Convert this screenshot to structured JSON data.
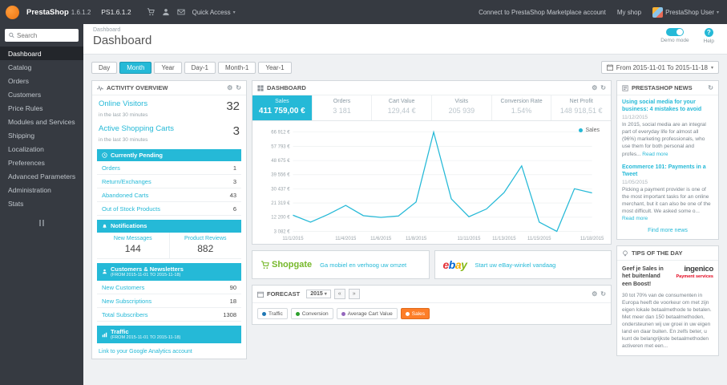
{
  "topbar": {
    "brand": "PrestaShop",
    "version": "1.6.1.2",
    "shop_name": "PS1.6.1.2",
    "quick_access": "Quick Access",
    "marketplace_link": "Connect to PrestaShop Marketplace account",
    "my_shop": "My shop",
    "user_name": "PrestaShop User"
  },
  "sidebar": {
    "search_placeholder": "Search",
    "items": [
      {
        "label": "Dashboard"
      },
      {
        "label": "Catalog"
      },
      {
        "label": "Orders"
      },
      {
        "label": "Customers"
      },
      {
        "label": "Price Rules"
      },
      {
        "label": "Modules and Services"
      },
      {
        "label": "Shipping"
      },
      {
        "label": "Localization"
      },
      {
        "label": "Preferences"
      },
      {
        "label": "Advanced Parameters"
      },
      {
        "label": "Administration"
      },
      {
        "label": "Stats"
      }
    ]
  },
  "page": {
    "breadcrumb": "Dashboard",
    "title": "Dashboard",
    "demo_mode": "Demo mode",
    "help": "Help"
  },
  "filters": {
    "buttons": [
      "Day",
      "Month",
      "Year",
      "Day-1",
      "Month-1",
      "Year-1"
    ],
    "active": "Month",
    "date_range": "From 2015-11-01 To 2015-11-18"
  },
  "activity": {
    "title": "ACTIVITY OVERVIEW",
    "online_visitors": {
      "label": "Online Visitors",
      "value": "32",
      "sub": "in the last 30 minutes"
    },
    "active_carts": {
      "label": "Active Shopping Carts",
      "value": "3",
      "sub": "in the last 30 minutes"
    },
    "pending": {
      "title": "Currently Pending",
      "rows": [
        {
          "label": "Orders",
          "value": "1"
        },
        {
          "label": "Return/Exchanges",
          "value": "3"
        },
        {
          "label": "Abandoned Carts",
          "value": "43"
        },
        {
          "label": "Out of Stock Products",
          "value": "6"
        }
      ]
    },
    "notifications": {
      "title": "Notifications",
      "cells": [
        {
          "label": "New Messages",
          "value": "144"
        },
        {
          "label": "Product Reviews",
          "value": "882"
        }
      ]
    },
    "customers": {
      "title": "Customers & Newsletters",
      "subtitle": "(FROM 2015-11-01 TO 2015-11-18)",
      "rows": [
        {
          "label": "New Customers",
          "value": "90"
        },
        {
          "label": "New Subscriptions",
          "value": "18"
        },
        {
          "label": "Total Subscribers",
          "value": "1308"
        }
      ]
    },
    "traffic": {
      "title": "Traffic",
      "subtitle": "(FROM 2015-11-01 TO 2015-11-18)",
      "link": "Link to your Google Analytics account"
    }
  },
  "dashboard": {
    "title": "DASHBOARD",
    "legend": "Sales",
    "kpis": [
      {
        "label": "Sales",
        "value": "411 759,00 €"
      },
      {
        "label": "Orders",
        "value": "3 181"
      },
      {
        "label": "Cart Value",
        "value": "129,44 €"
      },
      {
        "label": "Visits",
        "value": "205 939"
      },
      {
        "label": "Conversion Rate",
        "value": "1.54%"
      },
      {
        "label": "Net Profit",
        "value": "148 918,51 €"
      }
    ]
  },
  "chart_data": {
    "type": "line",
    "title": "Sales",
    "x": [
      "11/1/2015",
      "11/2/2015",
      "11/3/2015",
      "11/4/2015",
      "11/5/2015",
      "11/6/2015",
      "11/7/2015",
      "11/8/2015",
      "11/9/2015",
      "11/10/2015",
      "11/11/2015",
      "11/12/2015",
      "11/13/2015",
      "11/14/2015",
      "11/15/2015",
      "11/16/2015",
      "11/17/2015",
      "11/18/2015"
    ],
    "series": [
      {
        "name": "Sales",
        "color": "#25b9d7",
        "values": [
          13500,
          9000,
          14000,
          19800,
          13200,
          12100,
          13000,
          22000,
          66912,
          24000,
          12500,
          17500,
          28000,
          45200,
          9000,
          3082,
          30500,
          27800
        ]
      }
    ],
    "x_tick_labels": [
      "11/1/2015",
      "11/4/2015",
      "11/6/2015",
      "11/8/2015",
      "11/11/2015",
      "11/13/2015",
      "11/15/2015",
      "11/18/2015"
    ],
    "y_tick_labels": [
      "66 912 €",
      "57 793 €",
      "48 675 €",
      "39 556 €",
      "30 437 €",
      "21 319 €",
      "12 200 €",
      "3 082 €"
    ],
    "ylim": [
      3082,
      66912
    ],
    "grid": true,
    "legend_position": "top-right"
  },
  "modules": [
    {
      "name": "Shopgate",
      "link_text": "Ga mobiel en verhoog uw omzet"
    },
    {
      "name": "ebay",
      "letters": [
        "e",
        "b",
        "a",
        "y"
      ],
      "letter_colors": [
        "#e53238",
        "#0064d2",
        "#f5af02",
        "#86b817"
      ],
      "link_text": "Start uw eBay-winkel vandaag"
    }
  ],
  "forecast": {
    "title": "FORECAST",
    "year": "2015",
    "legend": [
      {
        "label": "Traffic",
        "color": "#1f77b4"
      },
      {
        "label": "Conversion",
        "color": "#2ca02c"
      },
      {
        "label": "Average Cart Value",
        "color": "#9467bd"
      },
      {
        "label": "Sales",
        "color": "#fd7e28",
        "active": true
      }
    ]
  },
  "news": {
    "title": "PRESTASHOP NEWS",
    "articles": [
      {
        "title": "Using social media for your business: 4 mistakes to avoid",
        "date": "11/12/2015",
        "excerpt": "In 2015, social media are an integral part of everyday life for almost all (96%) marketing professionals, who use them for both personal and profes...",
        "read_more": "Read more"
      },
      {
        "title": "Ecommerce 101: Payments in a Tweet",
        "date": "11/05/2015",
        "excerpt": "Picking a payment provider is one of the most important tasks for an online merchant, but it can also be one of the most difficult. We asked some o...",
        "read_more": "Read more"
      }
    ],
    "find_more": "Find more news"
  },
  "tips": {
    "title": "TIPS OF THE DAY",
    "headline": "Geef je Sales in het buitenland een Boost!",
    "brand": "ingenico",
    "brand_sub": "Payment services",
    "body": "30 tot 70% van de consumenten in Europa heeft de voorkeur om met zijn eigen lokale betaalmethode te betalen. Met meer dan 150 betaalmethoden, ondersteunen wij uw groei in uw eigen land en daar buiten. En zelfs beter, u kunt de belangrijkste betaalmethoden activeren met een..."
  },
  "colors": {
    "accent_blue": "#25b9d7",
    "active_orange": "#fd7e28",
    "topbar_dark": "#363a41",
    "shopgate_green": "#76b82a",
    "ingenico_red": "#e2001a"
  }
}
